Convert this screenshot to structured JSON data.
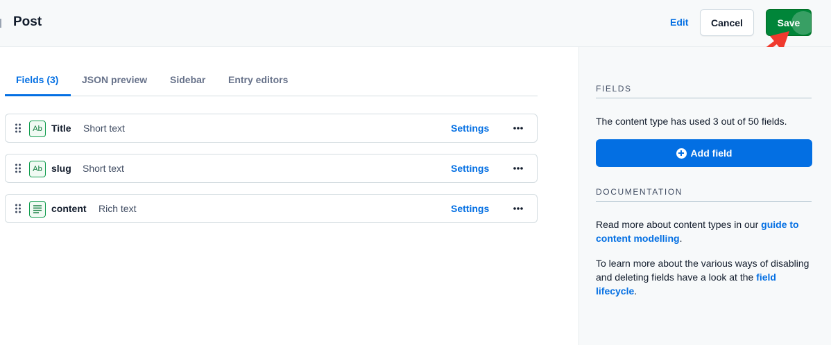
{
  "header": {
    "title": "Post",
    "edit_label": "Edit",
    "cancel_label": "Cancel",
    "save_label": "Save"
  },
  "tabs": [
    {
      "label": "Fields (3)",
      "active": true
    },
    {
      "label": "JSON preview",
      "active": false
    },
    {
      "label": "Sidebar",
      "active": false
    },
    {
      "label": "Entry editors",
      "active": false
    }
  ],
  "fields": [
    {
      "name": "Title",
      "type": "Short text",
      "icon": "short-text-icon",
      "settings_label": "Settings",
      "more_label": "•••"
    },
    {
      "name": "slug",
      "type": "Short text",
      "icon": "short-text-icon",
      "settings_label": "Settings",
      "more_label": "•••"
    },
    {
      "name": "content",
      "type": "Rich text",
      "icon": "rich-text-icon",
      "settings_label": "Settings",
      "more_label": "•••"
    }
  ],
  "icon_text": {
    "short_text": "Ab"
  },
  "sidebar": {
    "fields_heading": "FIELDS",
    "fields_usage": "The content type has used 3 out of 50 fields.",
    "add_field_label": "Add field",
    "documentation_heading": "DOCUMENTATION",
    "doc_p1_prefix": "Read more about content types in our ",
    "doc_p1_link": "guide to content modelling",
    "doc_p1_suffix": ".",
    "doc_p2_prefix": "To learn more about the various ways of disabling and deleting fields have a look at the ",
    "doc_p2_link": "field lifecycle",
    "doc_p2_suffix": "."
  },
  "colors": {
    "primary": "#036fe3",
    "save_green": "#008539",
    "icon_green": "#0d9b4b",
    "annotation_arrow": "#f03a2e"
  }
}
